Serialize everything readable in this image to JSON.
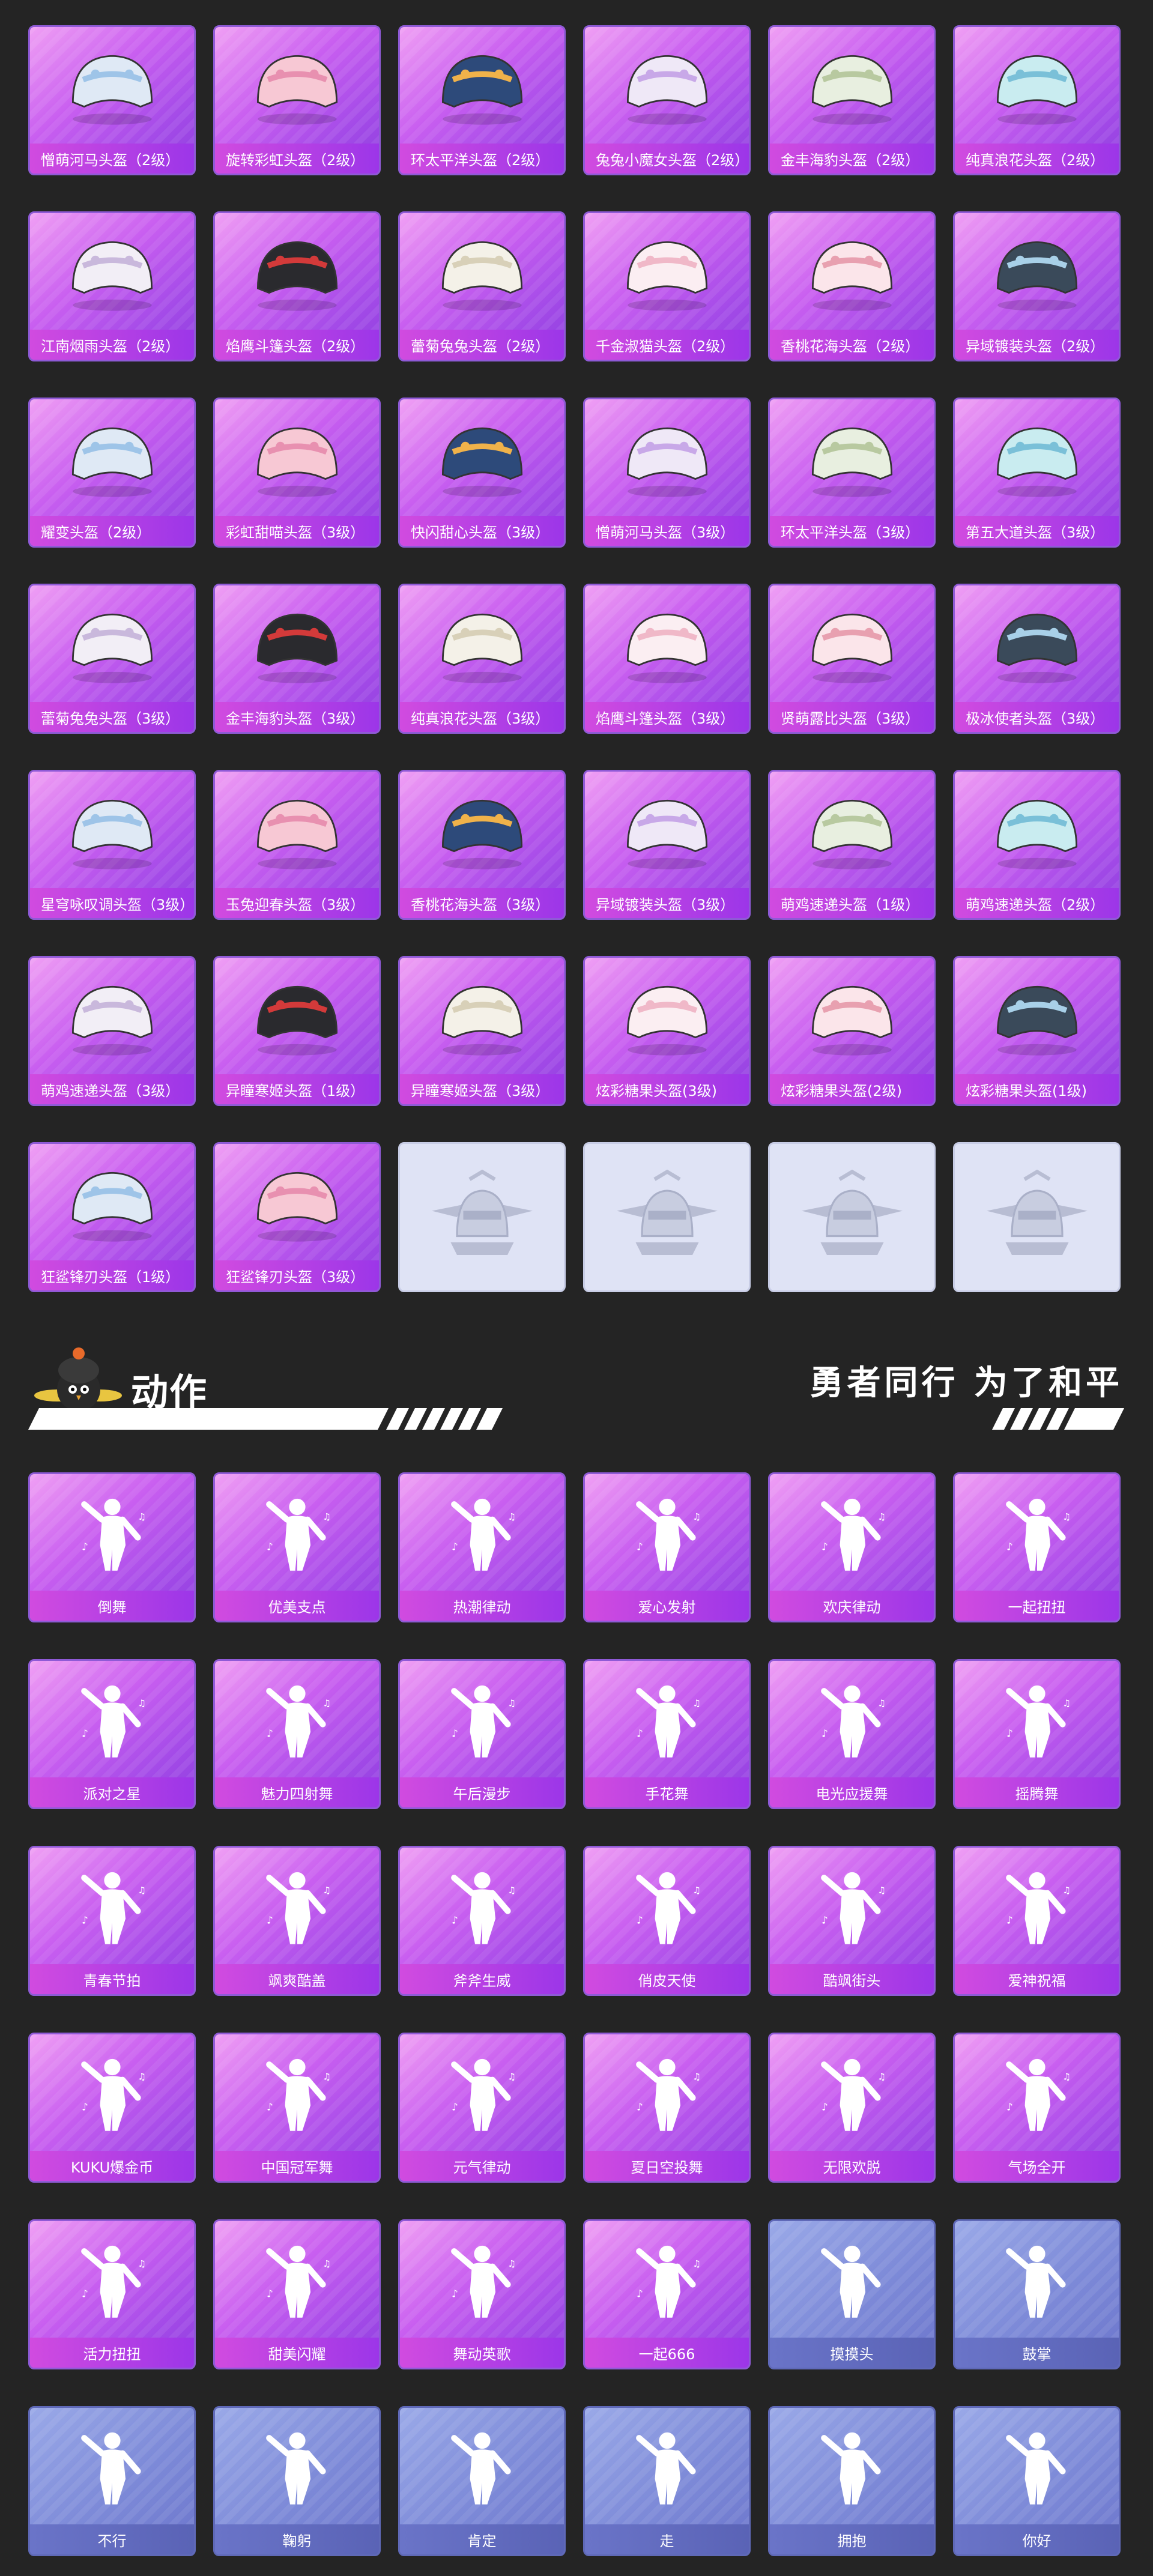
{
  "helmets": [
    "憎萌河马头盔（2级）",
    "旋转彩虹头盔（2级）",
    "环太平洋头盔（2级）",
    "兔兔小魔女头盔（2级）",
    "金丰海豹头盔（2级）",
    "纯真浪花头盔（2级）",
    "江南烟雨头盔（2级）",
    "焰鹰斗篷头盔（2级）",
    "蕾菊兔兔头盔（2级）",
    "千金淑猫头盔（2级）",
    "香桃花海头盔（2级）",
    "异域镀装头盔（2级）",
    "耀变头盔（2级）",
    "彩虹甜喵头盔（3级）",
    "快闪甜心头盔（3级）",
    "憎萌河马头盔（3级）",
    "环太平洋头盔（3级）",
    "第五大道头盔（3级）",
    "蕾菊兔兔头盔（3级）",
    "金丰海豹头盔（3级）",
    "纯真浪花头盔（3级）",
    "焰鹰斗篷头盔（3级）",
    "贤萌露比头盔（3级）",
    "极冰使者头盔（3级）",
    "星穹咏叹调头盔（3级）",
    "玉兔迎春头盔（3级）",
    "香桃花海头盔（3级）",
    "异域镀装头盔（3级）",
    "萌鸡速递头盔（1级）",
    "萌鸡速递头盔（2级）",
    "萌鸡速递头盔（3级）",
    "异瞳寒姬头盔（1级）",
    "异瞳寒姬头盔（3级）",
    "炫彩糖果头盔(3级)",
    "炫彩糖果头盔(2级)",
    "炫彩糖果头盔(1级)",
    "狂鲨锋刃头盔（1级）",
    "狂鲨锋刃头盔（3级）"
  ],
  "helmet_placeholders": 4,
  "section": {
    "title": "动作",
    "slogan": "勇者同行 为了和平"
  },
  "emotes": [
    {
      "label": "倒舞",
      "basic": false
    },
    {
      "label": "优美支点",
      "basic": false
    },
    {
      "label": "热潮律动",
      "basic": false
    },
    {
      "label": "爱心发射",
      "basic": false
    },
    {
      "label": "欢庆律动",
      "basic": false
    },
    {
      "label": "一起扭扭",
      "basic": false
    },
    {
      "label": "派对之星",
      "basic": false
    },
    {
      "label": "魅力四射舞",
      "basic": false
    },
    {
      "label": "午后漫步",
      "basic": false
    },
    {
      "label": "手花舞",
      "basic": false
    },
    {
      "label": "电光应援舞",
      "basic": false
    },
    {
      "label": "摇腾舞",
      "basic": false
    },
    {
      "label": "青春节拍",
      "basic": false
    },
    {
      "label": "飒爽酷盖",
      "basic": false
    },
    {
      "label": "斧斧生威",
      "basic": false
    },
    {
      "label": "俏皮天使",
      "basic": false
    },
    {
      "label": "酷飒街头",
      "basic": false
    },
    {
      "label": "爱神祝福",
      "basic": false
    },
    {
      "label": "KUKU爆金币",
      "basic": false
    },
    {
      "label": "中国冠军舞",
      "basic": false
    },
    {
      "label": "元气律动",
      "basic": false
    },
    {
      "label": "夏日空投舞",
      "basic": false
    },
    {
      "label": "无限欢脱",
      "basic": false
    },
    {
      "label": "气场全开",
      "basic": false
    },
    {
      "label": "活力扭扭",
      "basic": false
    },
    {
      "label": "甜美闪耀",
      "basic": false
    },
    {
      "label": "舞动英歌",
      "basic": false
    },
    {
      "label": "一起666",
      "basic": false
    },
    {
      "label": "摸摸头",
      "basic": true
    },
    {
      "label": "鼓掌",
      "basic": true
    },
    {
      "label": "不行",
      "basic": true
    },
    {
      "label": "鞠躬",
      "basic": true
    },
    {
      "label": "肯定",
      "basic": true
    },
    {
      "label": "走",
      "basic": true
    },
    {
      "label": "拥抱",
      "basic": true
    },
    {
      "label": "你好",
      "basic": true
    }
  ],
  "colors": {
    "background": "#242424",
    "card_purple": "#b54ff0",
    "card_basic": "#7d8ad8",
    "placeholder": "#dfe3f5"
  }
}
